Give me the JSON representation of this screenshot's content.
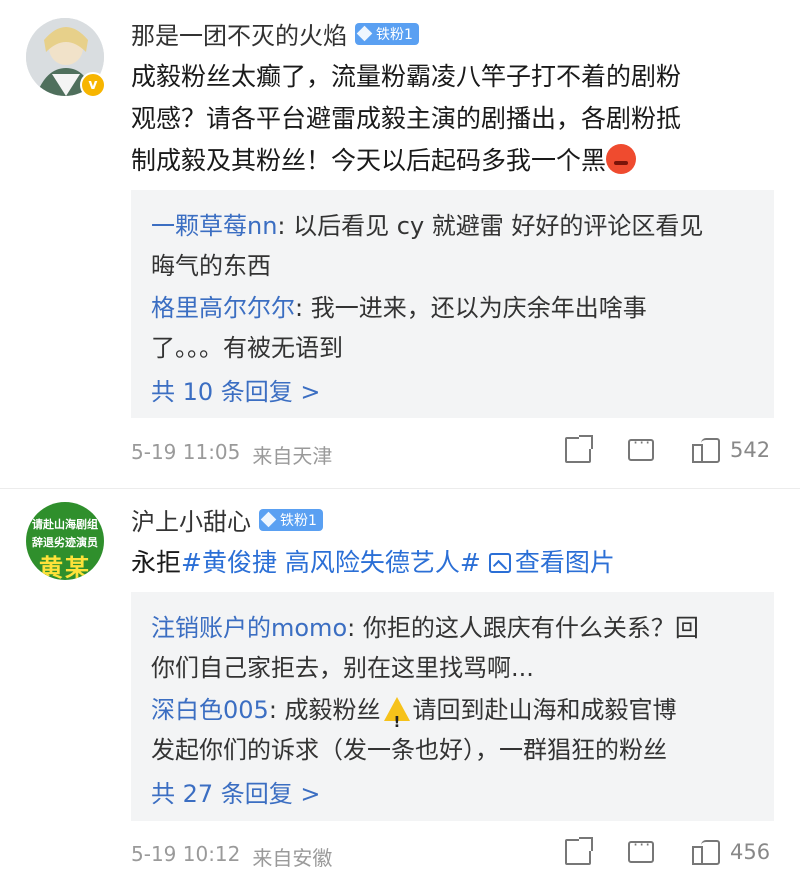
{
  "comments": [
    {
      "username": "那是一团不灭的火焰",
      "badge": "铁粉1",
      "verified_badge": "v",
      "text_lines": [
        "成毅粉丝太癫了，流量粉霸凌八竿子打不着的剧粉",
        "观感？请各平台避雷成毅主演的剧播出，各剧粉抵",
        "制成毅及其粉丝！今天以后起码多我一个黑"
      ],
      "emoji": "angry-face",
      "replies": [
        {
          "user": "一颗草莓nn",
          "text_line1": ": 以后看见 cy 就避雷 好好的评论区看见",
          "text_line2": "晦气的东西"
        },
        {
          "user": "格里高尔尔尔",
          "text_line1": ": 我一进来，还以为庆余年出啥事",
          "text_line2": "了。。。有被无语到"
        }
      ],
      "more_replies": "共 10 条回复 >",
      "date": "5-19 11:05",
      "location": "来自天津",
      "likes": "542"
    },
    {
      "username": "沪上小甜心",
      "badge": "铁粉1",
      "avatar_lines": [
        "请赴山海剧组",
        "辞退劣迹演员",
        "黄某"
      ],
      "text_prefix": "永拒",
      "hashtag": "#黄俊捷 高风险失德艺人#",
      "view_image": "查看图片",
      "replies": [
        {
          "user": "注销账户的momo",
          "text_line1": ": 你拒的这人跟庆有什么关系？回",
          "text_line2": "你们自己家拒去，别在这里找骂啊..."
        },
        {
          "user": "深白色005",
          "text_line1a": ": 成毅粉丝",
          "text_line1b": "请回到赴山海和成毅官博",
          "text_line2": "发起你们的诉求（发一条也好），一群猖狂的粉丝"
        }
      ],
      "more_replies": "共 27 条回复 >",
      "date": "5-19 10:12",
      "location": "来自安徽",
      "likes": "456"
    }
  ],
  "colors": {
    "link": "#3b6ec2",
    "hashtag": "#2b6fd6",
    "badge": "#5aa0f2",
    "meta": "#9a9a9a",
    "reply_bg": "#f3f4f5"
  }
}
